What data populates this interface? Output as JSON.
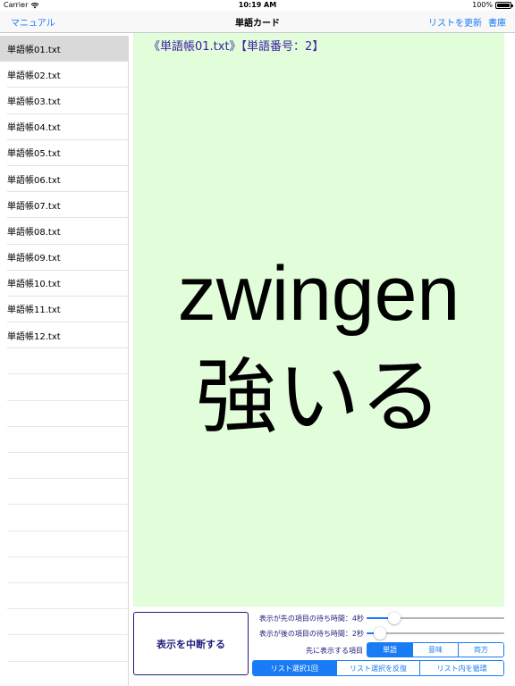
{
  "status_bar": {
    "carrier": "Carrier",
    "time": "10:19 AM",
    "battery": "100%"
  },
  "nav": {
    "left": "マニュアル",
    "title": "単語カード",
    "refresh": "リストを更新",
    "bookshelf": "書庫"
  },
  "sidebar": {
    "items": [
      {
        "label": "単語帳01.txt"
      },
      {
        "label": "単語帳02.txt"
      },
      {
        "label": "単語帳03.txt"
      },
      {
        "label": "単語帳04.txt"
      },
      {
        "label": "単語帳05.txt"
      },
      {
        "label": "単語帳06.txt"
      },
      {
        "label": "単語帳07.txt"
      },
      {
        "label": "単語帳08.txt"
      },
      {
        "label": "単語帳09.txt"
      },
      {
        "label": "単語帳10.txt"
      },
      {
        "label": "単語帳11.txt"
      },
      {
        "label": "単語帳12.txt"
      }
    ],
    "selected_index": 0
  },
  "card": {
    "header": "《単語帳01.txt》【単語番号：2】",
    "word": "zwingen",
    "meaning": "強いる",
    "background": "#e2fdd9"
  },
  "controls": {
    "stop_label": "表示を中断する",
    "first_wait": {
      "label": "表示が先の項目の待ち時間：4秒",
      "value": 4,
      "max": 20
    },
    "second_wait": {
      "label": "表示が後の項目の待ち時間：2秒",
      "value": 2,
      "max": 20
    },
    "order_label": "先に表示する項目",
    "order_options": [
      "単語",
      "意味",
      "両方"
    ],
    "order_selected": 0,
    "mode_options": [
      "リスト選択1回",
      "リスト選択を反復",
      "リスト内を循環"
    ],
    "mode_selected": 0
  },
  "colors": {
    "accent": "#1a7cf5",
    "dark_text": "#1e1e7a",
    "header_text": "#3a1ea6"
  }
}
